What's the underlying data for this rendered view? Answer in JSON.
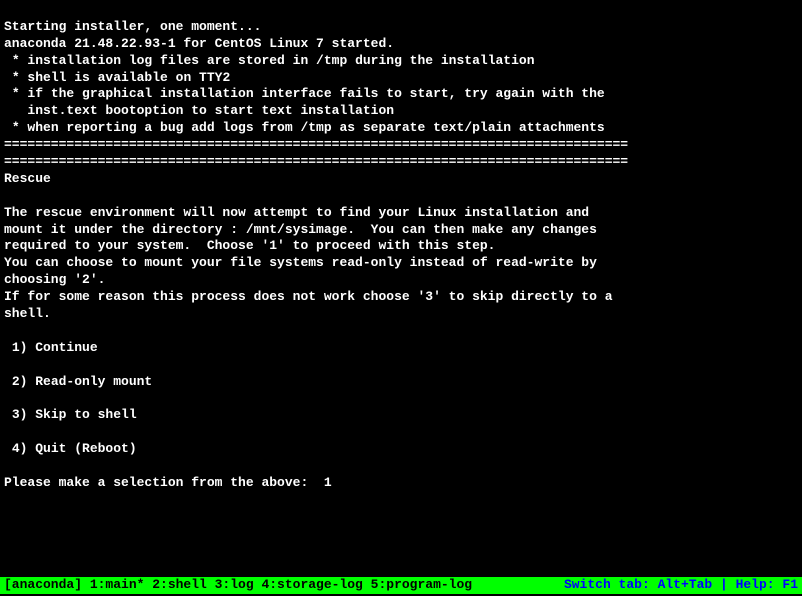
{
  "boot": {
    "line1": "Starting installer, one moment...",
    "line2": "anaconda 21.48.22.93-1 for CentOS Linux 7 started.",
    "bullet1": " * installation log files are stored in /tmp during the installation",
    "bullet2": " * shell is available on TTY2",
    "bullet3a": " * if the graphical installation interface fails to start, try again with the",
    "bullet3b": "   inst.text bootoption to start text installation",
    "bullet4": " * when reporting a bug add logs from /tmp as separate text/plain attachments",
    "separator": "================================================================================"
  },
  "rescue": {
    "title": "Rescue",
    "para1a": "The rescue environment will now attempt to find your Linux installation and",
    "para1b": "mount it under the directory : /mnt/sysimage.  You can then make any changes",
    "para1c": "required to your system.  Choose '1' to proceed with this step.",
    "para2a": "You can choose to mount your file systems read-only instead of read-write by",
    "para2b": "choosing '2'.",
    "para3a": "If for some reason this process does not work choose '3' to skip directly to a",
    "para3b": "shell."
  },
  "options": {
    "opt1": " 1) Continue",
    "opt2": " 2) Read-only mount",
    "opt3": " 3) Skip to shell",
    "opt4": " 4) Quit (Reboot)"
  },
  "prompt": {
    "text": "Please make a selection from the above:  ",
    "input": "1"
  },
  "statusbar": {
    "left": "[anaconda] 1:main* 2:shell  3:log  4:storage-log  5:program-log",
    "right": "Switch tab: Alt+Tab | Help: F1 "
  }
}
